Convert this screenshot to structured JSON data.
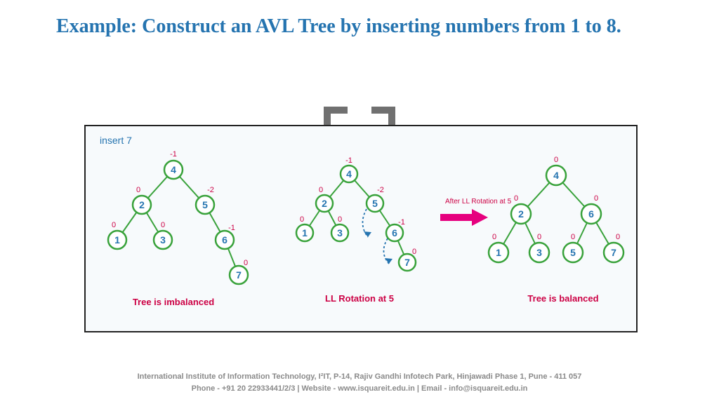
{
  "title": "Example: Construct an AVL Tree by inserting numbers from 1 to 8.",
  "panel": {
    "insert_label": "insert 7",
    "tree1": {
      "caption": "Tree is imbalanced",
      "nodes": [
        {
          "id": "4",
          "bf": "-1"
        },
        {
          "id": "2",
          "bf": "0"
        },
        {
          "id": "5",
          "bf": "-2"
        },
        {
          "id": "1",
          "bf": "0"
        },
        {
          "id": "3",
          "bf": "0"
        },
        {
          "id": "6",
          "bf": "-1"
        },
        {
          "id": "7",
          "bf": "0"
        }
      ]
    },
    "tree2": {
      "caption": "LL Rotation at 5",
      "nodes": [
        {
          "id": "4",
          "bf": "-1"
        },
        {
          "id": "2",
          "bf": "0"
        },
        {
          "id": "5",
          "bf": "-2"
        },
        {
          "id": "1",
          "bf": "0"
        },
        {
          "id": "3",
          "bf": "0"
        },
        {
          "id": "6",
          "bf": "-1"
        },
        {
          "id": "7",
          "bf": "0"
        }
      ]
    },
    "tree3": {
      "caption": "Tree is balanced",
      "after_label": "After LL Rotation at 5",
      "nodes": [
        {
          "id": "4",
          "bf": "0"
        },
        {
          "id": "2",
          "bf": "0"
        },
        {
          "id": "6",
          "bf": "0"
        },
        {
          "id": "1",
          "bf": "0"
        },
        {
          "id": "3",
          "bf": "0"
        },
        {
          "id": "5",
          "bf": "0"
        },
        {
          "id": "7",
          "bf": "0"
        }
      ]
    }
  },
  "footer": {
    "line1": "International Institute of Information Technology, I²IT, P-14, Rajiv Gandhi Infotech Park, Hinjawadi Phase 1, Pune - 411 057",
    "line2": "Phone - +91 20 22933441/2/3 | Website - www.isquareit.edu.in | Email - info@isquareit.edu.in"
  }
}
